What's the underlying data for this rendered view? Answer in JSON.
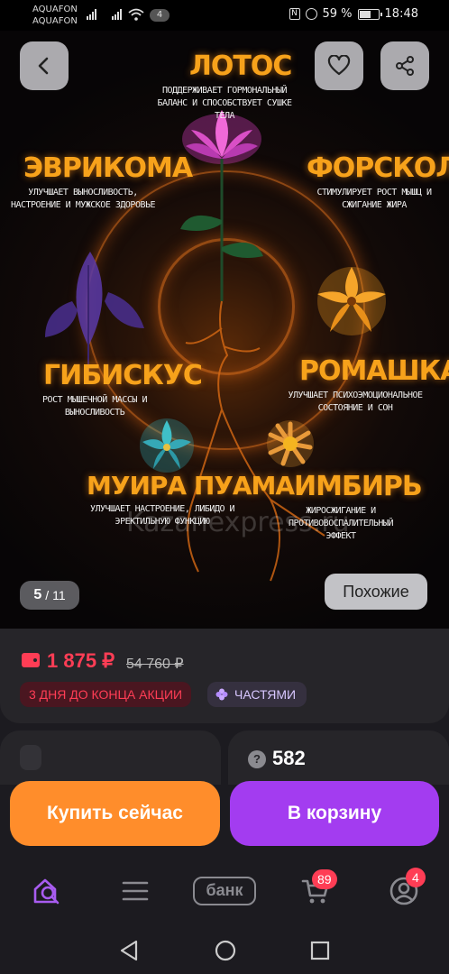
{
  "status_bar": {
    "carrier_1": "AQUAFON",
    "carrier_2": "AQUAFON",
    "notifications_count": "4",
    "battery": "59 %",
    "time": "18:48"
  },
  "gallery": {
    "current": "5",
    "total": "/ 11",
    "similar_label": "Похожие",
    "watermark": "Kazanexpress.ru",
    "herbs": {
      "lotus": {
        "title": "ЛОТОС",
        "desc": "ПОДДЕРЖИВАЕТ ГОРМОНАЛЬНЫЙ\nБАЛАНС И СПОСОБСТВУЕТ СУШКЕ\nТЕЛА"
      },
      "eurycoma": {
        "title": "ЭВРИКОМА",
        "desc": "УЛУЧШАЕТ ВЫНОСЛИВОСТЬ,\nНАСТРОЕНИЕ И МУЖСКОЕ ЗДОРОВЬЕ"
      },
      "forskolin": {
        "title": "ФОРСКОЛИН",
        "desc": "СТИМУЛИРУЕТ РОСТ МЫШЦ И\nСЖИГАНИЕ ЖИРА"
      },
      "hibiscus": {
        "title": "ГИБИСКУС",
        "desc": "РОСТ МЫШЕЧНОЙ МАССЫ И\nВЫНОСЛИВОСТЬ"
      },
      "chamomile": {
        "title": "РОМАШКА",
        "desc": "УЛУЧШАЕТ ПСИХОЭМОЦИОНАЛЬНОЕ\nСОСТОЯНИЕ И СОН"
      },
      "muira_puama": {
        "title": "МУИРА ПУАМА",
        "desc": "УЛУЧШАЕТ НАСТРОЕНИЕ, ЛИБИДО И\nЭРЕКТИЛЬНУЮ ФУНКЦИЮ"
      },
      "ginger": {
        "title": "ИМБИРЬ",
        "desc": "ЖИРОСЖИГАНИЕ И\nПРОТИВОВОСПАЛИТЕЛЬНЫЙ\nЭФФЕКТ"
      }
    }
  },
  "price": {
    "current": "1 875 ₽",
    "old": "54 760 ₽",
    "promo": "3 ДНЯ ДО КОНЦА АКЦИИ",
    "installments": "ЧАСТЯМИ"
  },
  "questions": {
    "count": "582",
    "icon": "question-icon"
  },
  "actions": {
    "buy_now": "Купить сейчас",
    "add_to_cart": "В корзину"
  },
  "bottom_nav": {
    "bank_label": "банк",
    "cart_badge": "89",
    "profile_badge": "4"
  },
  "colors": {
    "accent_orange": "#ff8d2b",
    "accent_purple": "#a33cf0",
    "price_red": "#ff3d55",
    "herb_title": "#f7a21b"
  }
}
